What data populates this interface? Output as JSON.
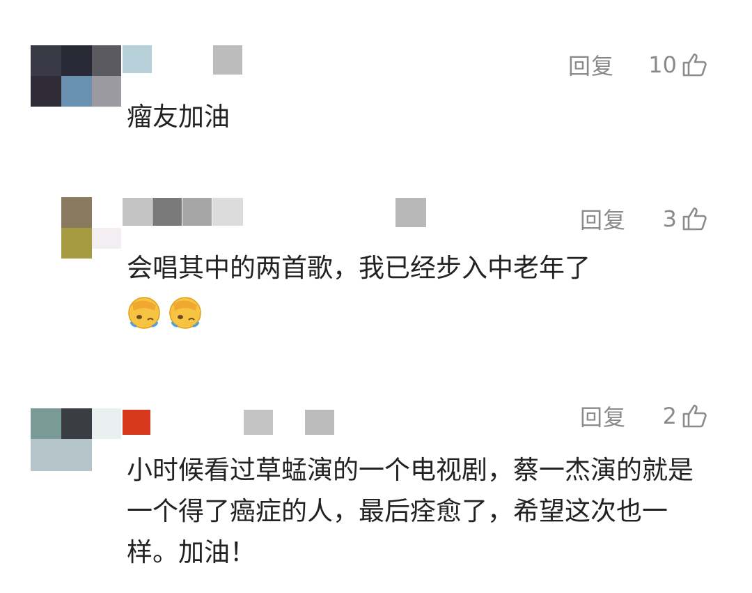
{
  "comments": [
    {
      "reply_label": "回复",
      "like_count": "10",
      "text": "瘤友加油",
      "avatar_colors": [
        "#3a3a46",
        "#2a2a36",
        "#5a5a60",
        "#b6cfd8",
        "#2e2a36",
        "#6a92b0",
        "#9a9aa0"
      ],
      "name_colors": [
        "#bcbcbc"
      ],
      "icons": [
        "thumbs-up-icon"
      ]
    },
    {
      "reply_label": "回复",
      "like_count": "3",
      "text": "会唱其中的两首歌，我已经步入中老年了",
      "emojis": [
        "facepalm-emoji",
        "facepalm-emoji"
      ],
      "avatar_colors": [
        "#8a7a60",
        "#a69a40",
        "#f2eef2"
      ],
      "name_colors": [
        "#c4c4c4",
        "#7a7a7a",
        "#a6a6a6",
        "#dcdcdc",
        "#b8b8b8"
      ],
      "icons": [
        "thumbs-up-icon"
      ]
    },
    {
      "reply_label": "回复",
      "like_count": "2",
      "text": "小时候看过草蜢演的一个电视剧，蔡一杰演的就是一个得了癌症的人，最后痊愈了，希望这次也一样。加油！",
      "avatar_colors": [
        "#7a9a98",
        "#3a3e44",
        "#b4c4c8",
        "#e8f0f0"
      ],
      "name_colors": [
        "#d8391e",
        "#c4c4c4",
        "#bcbcbc"
      ],
      "icons": [
        "thumbs-up-icon"
      ]
    }
  ]
}
